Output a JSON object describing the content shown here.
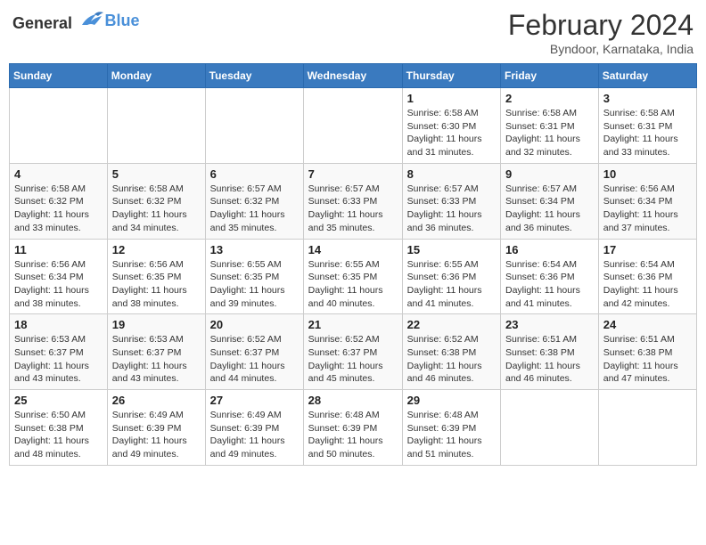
{
  "logo": {
    "general": "General",
    "blue": "Blue"
  },
  "title": {
    "month_year": "February 2024",
    "location": "Byndoor, Karnataka, India"
  },
  "headers": [
    "Sunday",
    "Monday",
    "Tuesday",
    "Wednesday",
    "Thursday",
    "Friday",
    "Saturday"
  ],
  "weeks": [
    [
      {
        "day": "",
        "info": ""
      },
      {
        "day": "",
        "info": ""
      },
      {
        "day": "",
        "info": ""
      },
      {
        "day": "",
        "info": ""
      },
      {
        "day": "1",
        "info": "Sunrise: 6:58 AM\nSunset: 6:30 PM\nDaylight: 11 hours and 31 minutes."
      },
      {
        "day": "2",
        "info": "Sunrise: 6:58 AM\nSunset: 6:31 PM\nDaylight: 11 hours and 32 minutes."
      },
      {
        "day": "3",
        "info": "Sunrise: 6:58 AM\nSunset: 6:31 PM\nDaylight: 11 hours and 33 minutes."
      }
    ],
    [
      {
        "day": "4",
        "info": "Sunrise: 6:58 AM\nSunset: 6:32 PM\nDaylight: 11 hours and 33 minutes."
      },
      {
        "day": "5",
        "info": "Sunrise: 6:58 AM\nSunset: 6:32 PM\nDaylight: 11 hours and 34 minutes."
      },
      {
        "day": "6",
        "info": "Sunrise: 6:57 AM\nSunset: 6:32 PM\nDaylight: 11 hours and 35 minutes."
      },
      {
        "day": "7",
        "info": "Sunrise: 6:57 AM\nSunset: 6:33 PM\nDaylight: 11 hours and 35 minutes."
      },
      {
        "day": "8",
        "info": "Sunrise: 6:57 AM\nSunset: 6:33 PM\nDaylight: 11 hours and 36 minutes."
      },
      {
        "day": "9",
        "info": "Sunrise: 6:57 AM\nSunset: 6:34 PM\nDaylight: 11 hours and 36 minutes."
      },
      {
        "day": "10",
        "info": "Sunrise: 6:56 AM\nSunset: 6:34 PM\nDaylight: 11 hours and 37 minutes."
      }
    ],
    [
      {
        "day": "11",
        "info": "Sunrise: 6:56 AM\nSunset: 6:34 PM\nDaylight: 11 hours and 38 minutes."
      },
      {
        "day": "12",
        "info": "Sunrise: 6:56 AM\nSunset: 6:35 PM\nDaylight: 11 hours and 38 minutes."
      },
      {
        "day": "13",
        "info": "Sunrise: 6:55 AM\nSunset: 6:35 PM\nDaylight: 11 hours and 39 minutes."
      },
      {
        "day": "14",
        "info": "Sunrise: 6:55 AM\nSunset: 6:35 PM\nDaylight: 11 hours and 40 minutes."
      },
      {
        "day": "15",
        "info": "Sunrise: 6:55 AM\nSunset: 6:36 PM\nDaylight: 11 hours and 41 minutes."
      },
      {
        "day": "16",
        "info": "Sunrise: 6:54 AM\nSunset: 6:36 PM\nDaylight: 11 hours and 41 minutes."
      },
      {
        "day": "17",
        "info": "Sunrise: 6:54 AM\nSunset: 6:36 PM\nDaylight: 11 hours and 42 minutes."
      }
    ],
    [
      {
        "day": "18",
        "info": "Sunrise: 6:53 AM\nSunset: 6:37 PM\nDaylight: 11 hours and 43 minutes."
      },
      {
        "day": "19",
        "info": "Sunrise: 6:53 AM\nSunset: 6:37 PM\nDaylight: 11 hours and 43 minutes."
      },
      {
        "day": "20",
        "info": "Sunrise: 6:52 AM\nSunset: 6:37 PM\nDaylight: 11 hours and 44 minutes."
      },
      {
        "day": "21",
        "info": "Sunrise: 6:52 AM\nSunset: 6:37 PM\nDaylight: 11 hours and 45 minutes."
      },
      {
        "day": "22",
        "info": "Sunrise: 6:52 AM\nSunset: 6:38 PM\nDaylight: 11 hours and 46 minutes."
      },
      {
        "day": "23",
        "info": "Sunrise: 6:51 AM\nSunset: 6:38 PM\nDaylight: 11 hours and 46 minutes."
      },
      {
        "day": "24",
        "info": "Sunrise: 6:51 AM\nSunset: 6:38 PM\nDaylight: 11 hours and 47 minutes."
      }
    ],
    [
      {
        "day": "25",
        "info": "Sunrise: 6:50 AM\nSunset: 6:38 PM\nDaylight: 11 hours and 48 minutes."
      },
      {
        "day": "26",
        "info": "Sunrise: 6:49 AM\nSunset: 6:39 PM\nDaylight: 11 hours and 49 minutes."
      },
      {
        "day": "27",
        "info": "Sunrise: 6:49 AM\nSunset: 6:39 PM\nDaylight: 11 hours and 49 minutes."
      },
      {
        "day": "28",
        "info": "Sunrise: 6:48 AM\nSunset: 6:39 PM\nDaylight: 11 hours and 50 minutes."
      },
      {
        "day": "29",
        "info": "Sunrise: 6:48 AM\nSunset: 6:39 PM\nDaylight: 11 hours and 51 minutes."
      },
      {
        "day": "",
        "info": ""
      },
      {
        "day": "",
        "info": ""
      }
    ]
  ]
}
